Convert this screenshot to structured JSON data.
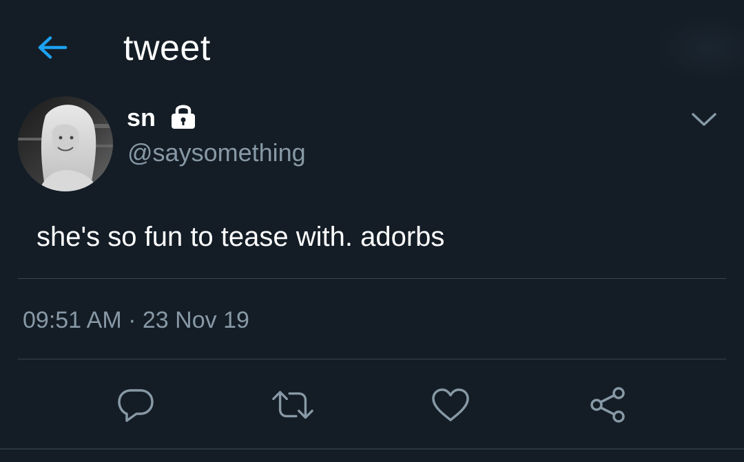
{
  "header": {
    "title": "tweet",
    "back_icon": "arrow-left-icon"
  },
  "author": {
    "display_name": "sn",
    "handle": "@saysomething",
    "protected_icon": "lock-icon",
    "menu_icon": "chevron-down-icon"
  },
  "tweet": {
    "text": "she's so fun to tease with. adorbs",
    "time": "09:51 AM",
    "separator": "·",
    "date": "23 Nov 19"
  },
  "actions": [
    {
      "name": "reply",
      "icon": "reply-icon"
    },
    {
      "name": "retweet",
      "icon": "retweet-icon"
    },
    {
      "name": "like",
      "icon": "heart-icon"
    },
    {
      "name": "share",
      "icon": "share-icon"
    }
  ],
  "colors": {
    "background": "#141d26",
    "accent": "#1da1f2",
    "secondary_text": "#8899a6",
    "icon": "#8899a6",
    "divider": "#38444d"
  }
}
